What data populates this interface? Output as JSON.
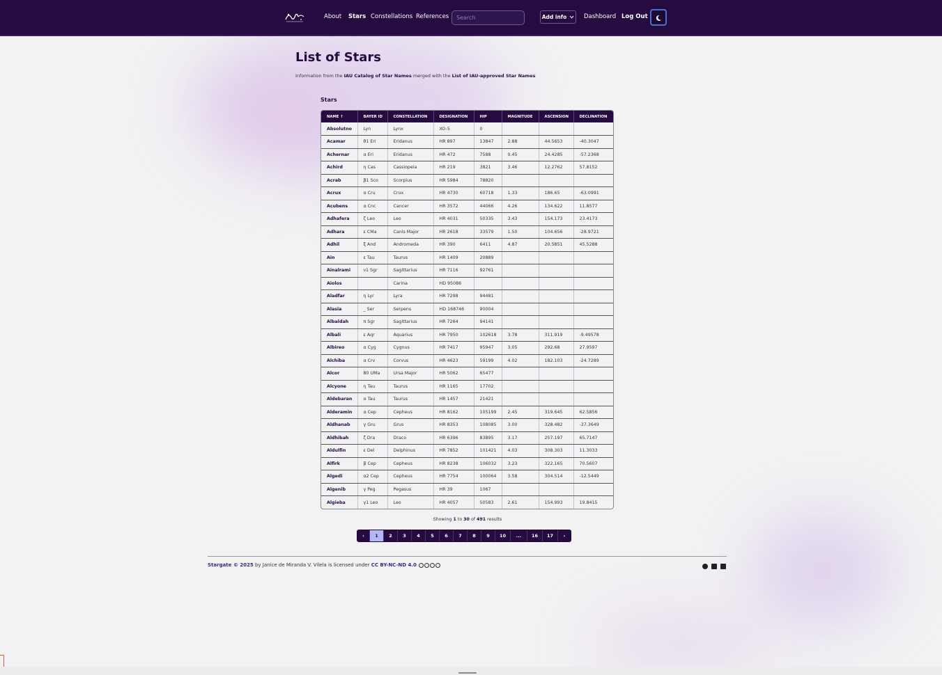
{
  "nav": {
    "links": [
      "About",
      "Stars",
      "Constellations",
      "References"
    ],
    "search_placeholder": "Search",
    "add_info": "Add info",
    "dashboard": "Dashboard",
    "logout": "Log Out",
    "accent": "#250b40"
  },
  "page": {
    "title": "List of Stars",
    "intro_pre": "Information from the ",
    "intro_link1": "IAU Catalog of Star Names",
    "intro_mid": " merged with the ",
    "intro_link2": "List of IAU-approved Star Names",
    "section": "Stars"
  },
  "table": {
    "headers": [
      "NAME ↑",
      "BAYER ID",
      "CONSTELLATION",
      "DESIGNATION",
      "HIP",
      "MAGNITUDE",
      "ASCENSION",
      "DECLINATION"
    ],
    "rows": [
      [
        "Absolutno",
        "Lyn",
        "Lynx",
        "XO-5",
        "0",
        "",
        "",
        ""
      ],
      [
        "Acamar",
        "θ1 Eri",
        "Eridanus",
        "HR 897",
        "13847",
        "2.88",
        "44.5653",
        "-40.3047"
      ],
      [
        "Achernar",
        "α Eri",
        "Eridanus",
        "HR 472",
        "7588",
        "0.45",
        "24.4285",
        "-57.2368"
      ],
      [
        "Achird",
        "η Cas",
        "Cassiopeia",
        "HR 219",
        "3821",
        "3.46",
        "12.2762",
        "57.8152"
      ],
      [
        "Acrab",
        "β1 Sco",
        "Scorpius",
        "HR 5984",
        "78820",
        "",
        "",
        ""
      ],
      [
        "Acrux",
        "α Cru",
        "Crux",
        "HR 4730",
        "60718",
        "1.33",
        "186.65",
        "-63.0991"
      ],
      [
        "Acubens",
        "α Cnc",
        "Cancer",
        "HR 3572",
        "44066",
        "4.26",
        "134.622",
        "11.8577"
      ],
      [
        "Adhafera",
        "ζ Leo",
        "Leo",
        "HR 4031",
        "50335",
        "3.43",
        "154.173",
        "23.4173"
      ],
      [
        "Adhara",
        "ε CMa",
        "Canis Major",
        "HR 2618",
        "33579",
        "1.50",
        "104.656",
        "-28.9721"
      ],
      [
        "Adhil",
        "ξ And",
        "Andromeda",
        "HR 390",
        "6411",
        "4.87",
        "20.5851",
        "45.5288"
      ],
      [
        "Ain",
        "ε Tau",
        "Taurus",
        "HR 1409",
        "20889",
        "",
        "",
        ""
      ],
      [
        "Ainalrami",
        "ν1 Sgr",
        "Sagittarius",
        "HR 7116",
        "92761",
        "",
        "",
        ""
      ],
      [
        "Aiolos",
        "",
        "Carina",
        "HD 95086",
        "",
        "",
        "",
        ""
      ],
      [
        "Aladfar",
        "η Lyr",
        "Lyra",
        "HR 7298",
        "94481",
        "",
        "",
        ""
      ],
      [
        "Alasia",
        "_ Ser",
        "Serpens",
        "HD 168746",
        "90004",
        "",
        "",
        ""
      ],
      [
        "Albaldah",
        "π Sgr",
        "Sagittarius",
        "HR 7264",
        "94141",
        "",
        "",
        ""
      ],
      [
        "Albali",
        "ε Aqr",
        "Aquarius",
        "HR 7950",
        "102618",
        "3.78",
        "311.919",
        "-9.49578"
      ],
      [
        "Albireo",
        "α Cyg",
        "Cygnus",
        "HR 7417",
        "95947",
        "3.05",
        "292.68",
        "27.9597"
      ],
      [
        "Alchiba",
        "α Crv",
        "Corvus",
        "HR 4623",
        "59199",
        "4.02",
        "182.103",
        "-24.7289"
      ],
      [
        "Alcor",
        "80 UMa",
        "Ursa Major",
        "HR 5062",
        "65477",
        "",
        "",
        ""
      ],
      [
        "Alcyone",
        "η Tau",
        "Taurus",
        "HR 1165",
        "17702",
        "",
        "",
        ""
      ],
      [
        "Aldebaran",
        "α Tau",
        "Taurus",
        "HR 1457",
        "21421",
        "",
        "",
        ""
      ],
      [
        "Alderamin",
        "α Cep",
        "Cepheus",
        "HR 8162",
        "105199",
        "2.45",
        "319.645",
        "62.5856"
      ],
      [
        "Aldhanab",
        "γ Gru",
        "Grus",
        "HR 8353",
        "108085",
        "3.00",
        "328.482",
        "-37.3649"
      ],
      [
        "Aldhibah",
        "ζ Dra",
        "Draco",
        "HR 6396",
        "83895",
        "3.17",
        "257.197",
        "65.7147"
      ],
      [
        "Aldulfin",
        "ε Del",
        "Delphinus",
        "HR 7852",
        "101421",
        "4.03",
        "308.303",
        "11.3033"
      ],
      [
        "Alfirk",
        "β Cep",
        "Cepheus",
        "HR 8238",
        "106032",
        "3.23",
        "322.165",
        "70.5607"
      ],
      [
        "Algedi",
        "α2 Cep",
        "Cepheus",
        "HR 7754",
        "100064",
        "3.58",
        "304.514",
        "-12.5449"
      ],
      [
        "Algenib",
        "γ Peg",
        "Pegasus",
        "HR 39",
        "1067",
        "",
        "",
        ""
      ],
      [
        "Algieba",
        "γ1 Leo",
        "Leo",
        "HR 4057",
        "50583",
        "2.61",
        "154.993",
        "19.8415"
      ]
    ]
  },
  "results": {
    "pre": "Showing ",
    "from": "1",
    "mid1": " to ",
    "to": "30",
    "mid2": " of ",
    "total": "491",
    "post": " results"
  },
  "pagination": {
    "prev": "‹",
    "pages": [
      "1",
      "2",
      "3",
      "4",
      "5",
      "6",
      "7",
      "8",
      "9",
      "10",
      "...",
      "16",
      "17"
    ],
    "current": "1",
    "next": "›"
  },
  "footer": {
    "brand": "Stargate © 2025",
    "by_text": " by Janice de Miranda V. Vilela is licensed under ",
    "license": "CC BY-NC-ND 4.0"
  }
}
